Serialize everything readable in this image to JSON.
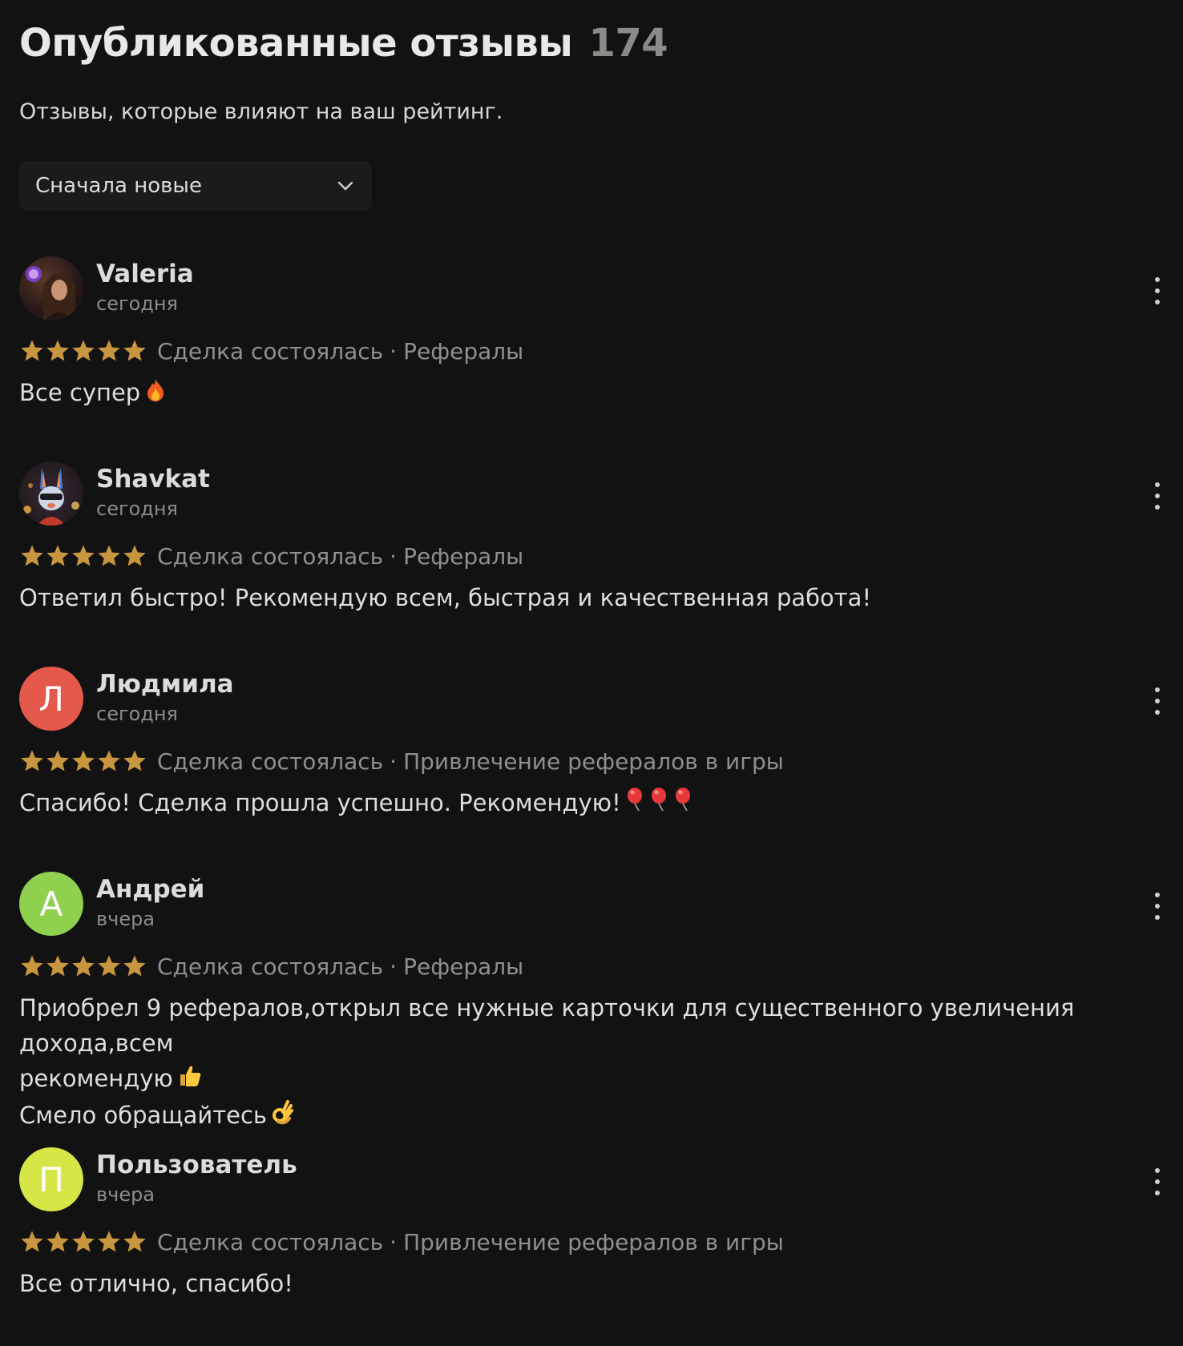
{
  "header": {
    "title": "Опубликованные отзывы",
    "count": "174",
    "subtitle": "Отзывы, которые влияют на ваш рейтинг."
  },
  "sort": {
    "selected": "Сначала новые",
    "icon": "chevron-down-icon"
  },
  "colors": {
    "background": "#121212",
    "star": "#c8963e",
    "avatar_l": "#e5594d",
    "avatar_a": "#8fd14f",
    "avatar_p": "#d6e646"
  },
  "reviews": [
    {
      "author": "Valeria",
      "date": "сегодня",
      "rating": 5,
      "status": "Сделка состоялась",
      "separator": "·",
      "category": "Рефералы",
      "text": [
        "Все супер"
      ],
      "emoji": "fire-emoji"
    },
    {
      "author": "Shavkat",
      "date": "сегодня",
      "rating": 5,
      "status": "Сделка состоялась",
      "separator": "·",
      "category": "Рефералы",
      "text": [
        "Ответил быстро! Рекомендую всем, быстрая и качественная работа!"
      ]
    },
    {
      "author": "Людмила",
      "initial": "Л",
      "date": "сегодня",
      "rating": 5,
      "status": "Сделка состоялась",
      "separator": "·",
      "category": "Привлечение рефералов в игры",
      "text": [
        "Спасибо! Сделка прошла успешно. Рекомендую!"
      ],
      "emoji": "balloon-emoji"
    },
    {
      "author": "Андрей",
      "initial": "А",
      "date": "вчера",
      "rating": 5,
      "status": "Сделка состоялась",
      "separator": "·",
      "category": "Рефералы",
      "text": [
        "Приобрел 9 рефералов,открыл все нужные карточки для существенного увеличения дохода,всем",
        "рекомендую",
        "Смело обращайтесь"
      ],
      "emoji": "thumbs-up-emoji",
      "emoji2": "ok-hand-emoji"
    },
    {
      "author": "Пользователь",
      "initial": "П",
      "date": "вчера",
      "rating": 5,
      "status": "Сделка состоялась",
      "separator": "·",
      "category": "Привлечение рефералов в игры",
      "text": [
        "Все отлично, спасибо!"
      ]
    }
  ]
}
